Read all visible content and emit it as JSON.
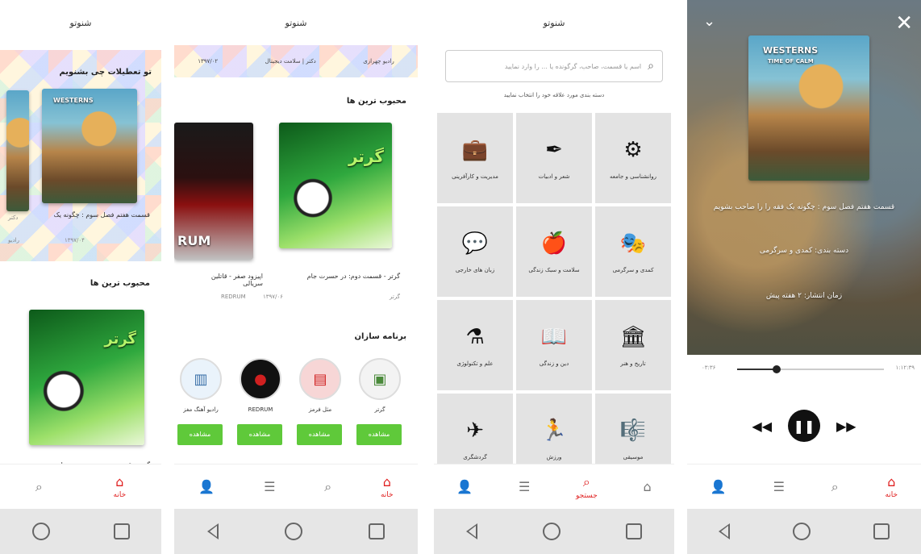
{
  "app_title": "شنوتو",
  "nav": {
    "home_label": "خانه",
    "search_label": "جستجو"
  },
  "screen1": {
    "banner_title": "تو تعطیلات چی بشنویم",
    "banner_caption": "قسمت هفتم فصل سوم : چگونه یک",
    "banner_sub": "چگونه",
    "banner_left_tag": "دکتر",
    "banner_left_sub": "رادیو",
    "banner_date": "۱۳۹۷/۰۴",
    "section_title": "محبوب ترین ها",
    "football_title": "گرتر",
    "bottom_caption": "گرتر - قسمت دوم: در حسرت جام"
  },
  "screen2": {
    "banner_items": [
      "رادیو چهرازی",
      "دکتر | سلامت دیجیتال",
      "۱۳۹۷/۰۲"
    ],
    "popular_title": "محبوب ترین ها",
    "items": [
      {
        "title": "گرتر - قسمت دوم: در حسرت جام",
        "sub": "گرتر",
        "sub2": "۱۳۹۷/۰۶"
      },
      {
        "title": "اپیزود صفر - قاتلین سریالی",
        "sub": "REDRUM",
        "sub2": ""
      }
    ],
    "cover_text": "گرتر",
    "red_cover_text": "RUM",
    "producers_title": "برنامه سازان",
    "producers": [
      {
        "name": "گرتر",
        "button": "مشاهده"
      },
      {
        "name": "مثل فرمز",
        "button": "مشاهده"
      },
      {
        "name": "REDRUM",
        "button": "مشاهده"
      },
      {
        "name": "رادیو آهنگ مغز",
        "button": "مشاهده"
      }
    ]
  },
  "screen3": {
    "search_placeholder": "اسم یا قسمت، صاحب، گرگونده یا ... را وارد نمایید",
    "hint": "دسته بندی مورد علاقه خود را انتخاب نمایید",
    "categories": [
      {
        "label": "مدیریت و کارآفرینی",
        "icon": "briefcase-icon",
        "glyph": "💼"
      },
      {
        "label": "شعر و ادبیات",
        "icon": "quill-icon",
        "glyph": "✒"
      },
      {
        "label": "روانشناسی و جامعه",
        "icon": "brain-icon",
        "glyph": "⚙"
      },
      {
        "label": "زبان های خارجی",
        "icon": "speech-icon",
        "glyph": "💬"
      },
      {
        "label": "سلامت و سبک زندگی",
        "icon": "apple-icon",
        "glyph": "🍎"
      },
      {
        "label": "کمدی و سرگرمی",
        "icon": "mask-icon",
        "glyph": "🎭"
      },
      {
        "label": "علم و تکنولوژی",
        "icon": "flask-icon",
        "glyph": "⚗"
      },
      {
        "label": "دین و زندگی",
        "icon": "book-icon",
        "glyph": "📖"
      },
      {
        "label": "تاریخ و هنر",
        "icon": "museum-icon",
        "glyph": "🏛"
      },
      {
        "label": "گردشگری",
        "icon": "airplane-icon",
        "glyph": "✈"
      },
      {
        "label": "ورزش",
        "icon": "runner-icon",
        "glyph": "🏃"
      },
      {
        "label": "موسیقی",
        "icon": "music-icon",
        "glyph": "🎼"
      }
    ]
  },
  "screen4": {
    "cover_title": "WESTERNS",
    "cover_sub": "TIME OF CALM",
    "episode_title": "قسمت هفتم فصل سوم : چگونه یک فقه را را صاحب بشویم",
    "category": "دسته بندی: کمدی و سرگرمی",
    "published": "زمان انتشار: ۲ هفته پیش",
    "time_elapsed": "۰۳:۳۶",
    "time_total": "۱:۱۲:۳۹",
    "progress": 0.27
  }
}
